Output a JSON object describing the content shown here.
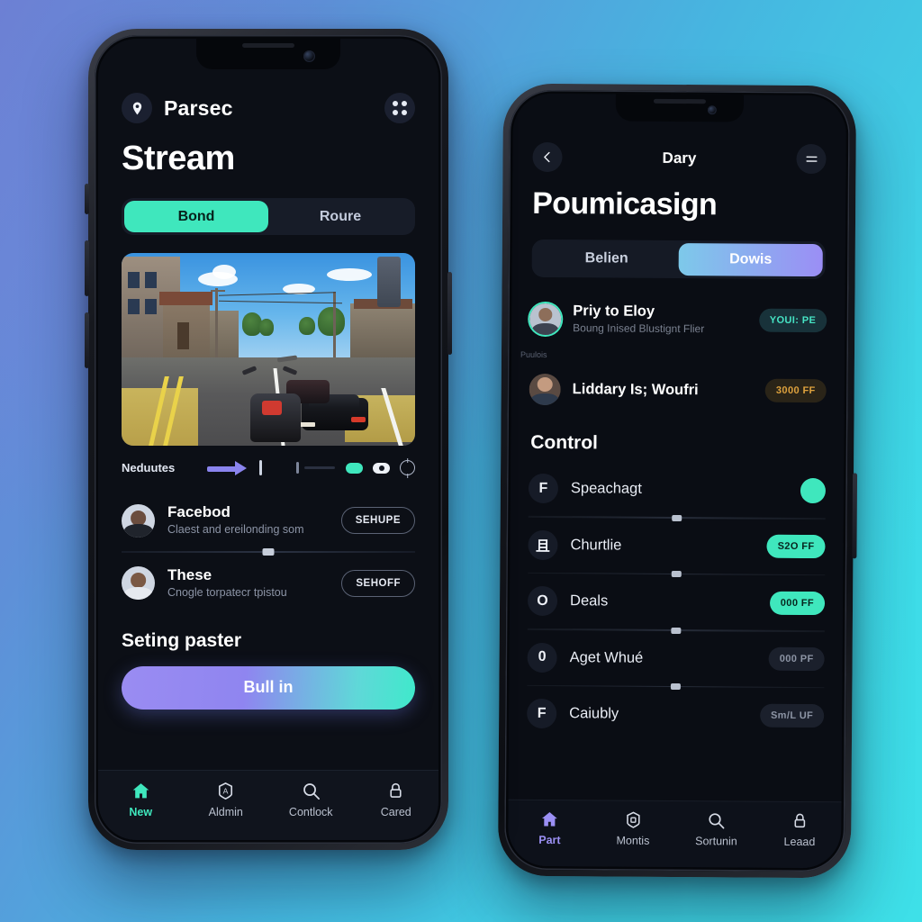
{
  "background": {
    "from": "#6d80d4",
    "to": "#3ee0e8"
  },
  "left_phone": {
    "header": {
      "brand": "Parsec",
      "logo_icon": "location-pin-icon",
      "grid_icon": "grid-apps-icon"
    },
    "page_title": "Stream",
    "segmented": {
      "options": [
        "Bond",
        "Roure"
      ],
      "selected": "Bond",
      "active_color": "#3fe7bd"
    },
    "preview": {
      "alt": "racing game street scene screenshot"
    },
    "controls": {
      "label": "Neduutes",
      "arrow_color": "#8a84ee",
      "indicators": [
        "status-pill-teal",
        "record-pill-white",
        "target-icon"
      ]
    },
    "list": [
      {
        "title": "Facebod",
        "subtitle": "Claest and ereilonding som",
        "action": "SEHUPE"
      },
      {
        "title": "These",
        "subtitle": "Cnogle torpatecr tpistou",
        "action": "SEHOFF"
      }
    ],
    "section_title": "Seting paster",
    "cta": {
      "label": "Bull in",
      "from": "#9a8cf2",
      "to": "#3fe9cb"
    },
    "tabbar": [
      {
        "label": "New",
        "icon": "home-icon",
        "active": true
      },
      {
        "label": "Aldmin",
        "icon": "badge-a-icon",
        "active": false
      },
      {
        "label": "Contlock",
        "icon": "search-icon",
        "active": false
      },
      {
        "label": "Cared",
        "icon": "lock-icon",
        "active": false
      }
    ]
  },
  "right_phone": {
    "nav": {
      "back_icon": "chevron-left-icon",
      "title": "Dary",
      "menu_icon": "hamburger-menu-icon"
    },
    "page_title": "Poumicasign",
    "segmented": {
      "options": [
        "Belien",
        "Dowis"
      ],
      "selected": "Dowis",
      "from": "#7dc9ea",
      "to": "#9b8ef5"
    },
    "list": [
      {
        "title": "Priy to Eloy",
        "subtitle": "Boung Inised Blustignt Flier",
        "caption": "Puulois",
        "badge": "YOUI: PE",
        "badge_style": "teal"
      },
      {
        "title": "Liddary Is; Woufri",
        "subtitle": "",
        "caption": "",
        "badge": "3000 FF",
        "badge_style": "amber"
      }
    ],
    "section_title": "Control",
    "control_rows": [
      {
        "icon_letter": "F",
        "name": "Speachagt",
        "control": "toggle",
        "badge": "",
        "badge_style": ""
      },
      {
        "icon_letter": "且",
        "name": "Churtlie",
        "control": "badge",
        "badge": "S2O FF",
        "badge_style": "solid"
      },
      {
        "icon_letter": "O",
        "name": "Deals",
        "control": "badge",
        "badge": "000 FF",
        "badge_style": "solid"
      },
      {
        "icon_letter": "0",
        "name": "Aget Whué",
        "control": "badge",
        "badge": "000 PF",
        "badge_style": "grey"
      },
      {
        "icon_letter": "F",
        "name": "Caiubly",
        "control": "badge",
        "badge": "Sm/L UF",
        "badge_style": "grey"
      }
    ],
    "tabbar": [
      {
        "label": "Part",
        "icon": "home-icon",
        "active": true
      },
      {
        "label": "Montis",
        "icon": "badge-square-icon",
        "active": false
      },
      {
        "label": "Sortunin",
        "icon": "search-icon",
        "active": false
      },
      {
        "label": "Leaad",
        "icon": "lock-icon",
        "active": false
      }
    ]
  }
}
